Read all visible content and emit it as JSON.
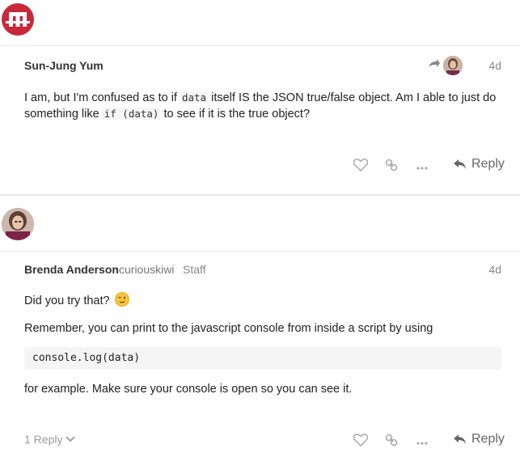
{
  "post1": {
    "username": "Sun-Jung Yum",
    "date": "4d",
    "text_parts": {
      "t1": "I am, but I'm confused as to if ",
      "code1": "data",
      "t2": " itself IS the JSON true/false object. Am I able to just do",
      "t3": "something like ",
      "code2": "if (data)",
      "t4": " to see if it is the true object?"
    },
    "reply_label": "Reply"
  },
  "post2": {
    "username": "Brenda Anderson",
    "handle": "curiouskiwi",
    "role": "Staff",
    "date": "4d",
    "line1": "Did you try that?",
    "line2": "Remember, you can print to the javascript console from inside a script by using",
    "code": "console.log(data)",
    "line3": "for example. Make sure your console is open so you can see it.",
    "replies_label": "1 Reply",
    "reply_label": "Reply"
  },
  "icons": [
    "logo-icon",
    "reply-arrow-icon",
    "heart-icon",
    "link-icon",
    "more-icon",
    "reply-icon",
    "chevron-down-icon",
    "wink-emoji-icon"
  ],
  "colors": {
    "brand": "#c8283a",
    "muted": "#999999"
  }
}
